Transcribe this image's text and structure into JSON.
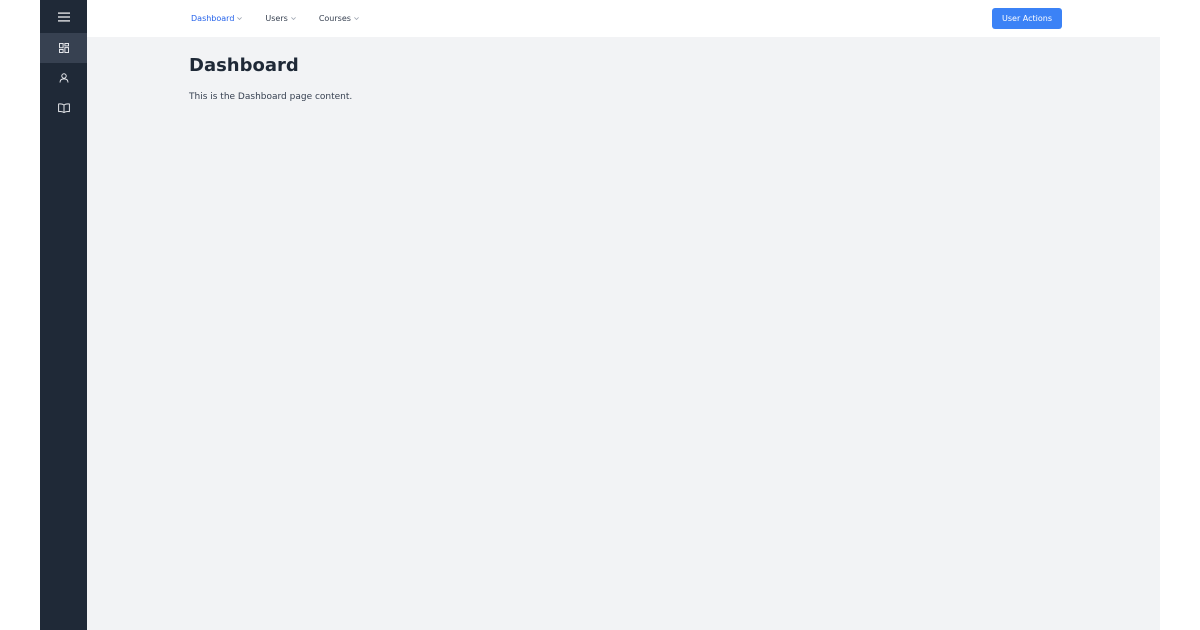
{
  "sidebar": {
    "items": [
      {
        "icon": "menu-icon"
      },
      {
        "icon": "dashboard-icon",
        "active": true
      },
      {
        "icon": "user-icon"
      },
      {
        "icon": "book-icon"
      }
    ]
  },
  "topnav": {
    "items": [
      {
        "label": "Dashboard",
        "active": true
      },
      {
        "label": "Users"
      },
      {
        "label": "Courses"
      }
    ],
    "action_label": "User Actions"
  },
  "page": {
    "title": "Dashboard",
    "content": "This is the Dashboard page content."
  },
  "colors": {
    "sidebar_bg": "#1f2937",
    "sidebar_active": "#374151",
    "accent": "#3b82f6",
    "active_link": "#2563eb",
    "content_bg": "#f2f3f5"
  }
}
